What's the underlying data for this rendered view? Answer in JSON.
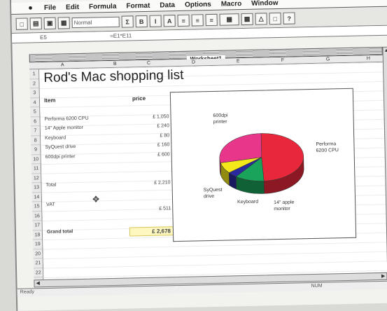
{
  "menubar": {
    "items": [
      "File",
      "Edit",
      "Formula",
      "Format",
      "Data",
      "Options",
      "Macro",
      "Window"
    ]
  },
  "toolbar": {
    "style_value": "Normal",
    "buttons": [
      "B",
      "I",
      "A",
      "Σ"
    ]
  },
  "formula_bar": {
    "cell_ref": "E5",
    "formula": "=E1*E11"
  },
  "window": {
    "title": "Worksheet1"
  },
  "columns": [
    "A",
    "B",
    "C",
    "D",
    "E",
    "F",
    "G",
    "H"
  ],
  "rows": [
    "1",
    "2",
    "3",
    "4",
    "5",
    "6",
    "7",
    "8",
    "9",
    "10",
    "11",
    "12",
    "13",
    "14",
    "15",
    "16",
    "17",
    "18",
    "19",
    "20",
    "21",
    "22"
  ],
  "sheet": {
    "title": "Rod's Mac shopping list",
    "item_header": "Item",
    "price_header": "price",
    "items": [
      {
        "name": "Performa 6200 CPU",
        "price": "£ 1,050"
      },
      {
        "name": "14\" Apple monitor",
        "price": "£ 240"
      },
      {
        "name": "Keyboard",
        "price": "£ 80"
      },
      {
        "name": "SyQuest drive",
        "price": "£ 160"
      },
      {
        "name": "600dpi printer",
        "price": "£ 600"
      }
    ],
    "total_label": "Total",
    "total_value": "£ 2,210",
    "vat_label": "VAT",
    "vat_value": "£ 511",
    "grand_label": "Grand total",
    "grand_value": "£ 2,678"
  },
  "chart_data": {
    "type": "pie",
    "title": "",
    "categories": [
      "Performa 6200 CPU",
      "14\" apple monitor",
      "Keyboard",
      "SyQuest drive",
      "600dpi printer"
    ],
    "values": [
      1050,
      240,
      80,
      160,
      600
    ],
    "colors": [
      "#e8283a",
      "#1aa35a",
      "#2a2aa0",
      "#f2e81a",
      "#e8378a"
    ],
    "labels": {
      "printer": [
        "600dpi",
        "printer"
      ],
      "cpu": [
        "Performa",
        "6200 CPU"
      ],
      "drive": [
        "SyQuest",
        "drive"
      ],
      "keyboard": [
        "Keyboard"
      ],
      "monitor": [
        "14\" apple",
        "monitor"
      ]
    }
  },
  "status": {
    "left": "Ready",
    "right": "NUM"
  }
}
